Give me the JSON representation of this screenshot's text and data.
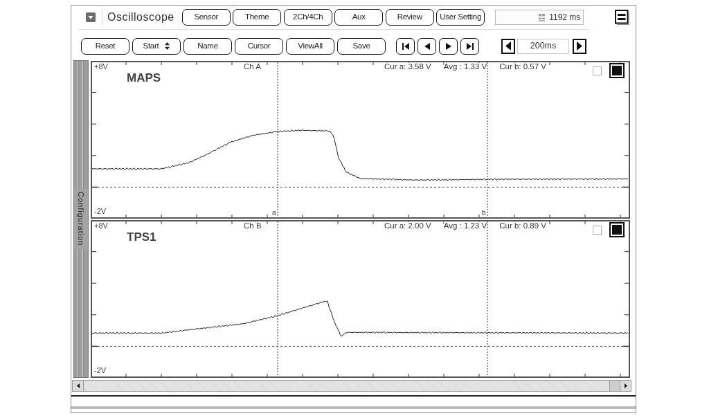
{
  "window": {
    "title": "Oscilloscope"
  },
  "top_toolbar": {
    "buttons": [
      "Sensor",
      "Theme",
      "2Ch/4Ch",
      "Aux",
      "Review",
      "User Setting"
    ],
    "time_readout": "1192 ms"
  },
  "control_bar": {
    "buttons": [
      {
        "label": "Reset",
        "kind": "plain"
      },
      {
        "label": "Start",
        "kind": "stepper"
      },
      {
        "label": "Name",
        "kind": "plain"
      },
      {
        "label": "Cursor",
        "kind": "plain"
      },
      {
        "label": "ViewAll",
        "kind": "plain"
      },
      {
        "label": "Save",
        "kind": "plain"
      }
    ],
    "playback_buttons": [
      {
        "kind": "first"
      },
      {
        "kind": "previous"
      },
      {
        "kind": "next"
      },
      {
        "kind": "last"
      }
    ],
    "timebase": {
      "value": "200ms"
    }
  },
  "sidebar": {
    "tab": "Configuration"
  },
  "channels": [
    {
      "scale_top": "+8V",
      "scale_bottom": "-2V",
      "channel": "Ch A",
      "name": "MAPS",
      "readouts": [
        "Cur a: 3.58 V",
        "Avg : 1.33 V",
        "Cur b: 0.57 V"
      ],
      "toggles": [
        {
          "checked": false
        },
        {
          "checked": true
        }
      ],
      "cursor_labels": [
        "a",
        "b"
      ]
    },
    {
      "scale_top": "+8V",
      "scale_bottom": "-2V",
      "channel": "Ch B",
      "name": "TPS1",
      "readouts": [
        "Cur a: 2.00 V",
        "Avg : 1.23 V",
        "Cur b: 0.89 V"
      ],
      "toggles": [
        {
          "checked": false
        },
        {
          "checked": true
        }
      ]
    }
  ]
}
